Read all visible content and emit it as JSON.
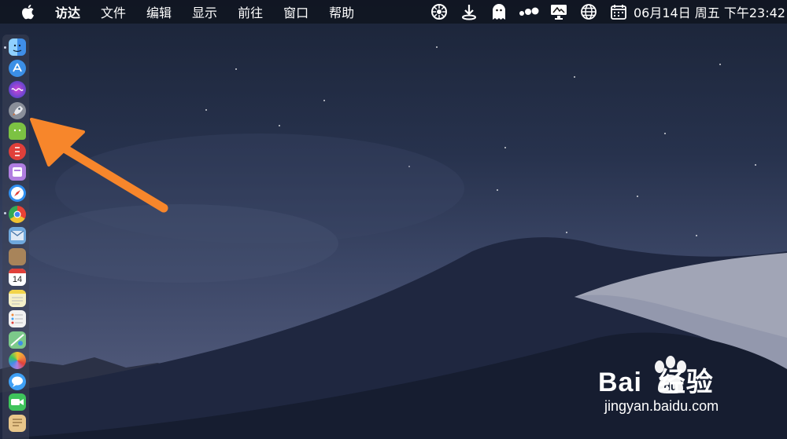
{
  "menubar": {
    "app_name": "访达",
    "items": [
      "文件",
      "编辑",
      "显示",
      "前往",
      "窗口",
      "帮助"
    ],
    "clock": "06月14日 周五 下午23:42",
    "tray_icons": [
      "dashboard-icon",
      "download-icon",
      "ghost-icon",
      "dots-icon",
      "monitor-icon",
      "globe-icon",
      "calendar-icon"
    ]
  },
  "dock": {
    "items": [
      {
        "name": "finder-icon",
        "color": "#4aa3f0"
      },
      {
        "name": "app-store-icon",
        "color": "#3b8fe6"
      },
      {
        "name": "siri-icon",
        "color": "#6b4fd8"
      },
      {
        "name": "launchpad-icon",
        "color": "#8a8f99"
      },
      {
        "name": "android-icon",
        "color": "#7cc243"
      },
      {
        "name": "red-app-icon",
        "color": "#e0403a"
      },
      {
        "name": "purple-app-icon",
        "color": "#b07ee0"
      },
      {
        "name": "safari-icon",
        "color": "#2f8ff0"
      },
      {
        "name": "chrome-icon",
        "color": "#f2c230"
      },
      {
        "name": "mail-icon",
        "color": "#6fa8dc"
      },
      {
        "name": "notes-book-icon",
        "color": "#a8845a"
      },
      {
        "name": "calendar-icon",
        "color": "#ffffff"
      },
      {
        "name": "notes-icon",
        "color": "#f5f0c8"
      },
      {
        "name": "reminders-icon",
        "color": "#f2f2f2"
      },
      {
        "name": "maps-icon",
        "color": "#7cc98a"
      },
      {
        "name": "photos-icon",
        "color": "#f08a3c"
      },
      {
        "name": "messages-icon",
        "color": "#3fa0f5"
      },
      {
        "name": "facetime-icon",
        "color": "#3ec45b"
      },
      {
        "name": "doc-icon",
        "color": "#e8c68a"
      }
    ],
    "calendar_day": "14"
  },
  "watermark": {
    "title": "Bai  经验",
    "subtitle": "jingyan.baidu.com"
  },
  "colors": {
    "arrow": "#f7862b",
    "menubar_bg": "#101622"
  }
}
